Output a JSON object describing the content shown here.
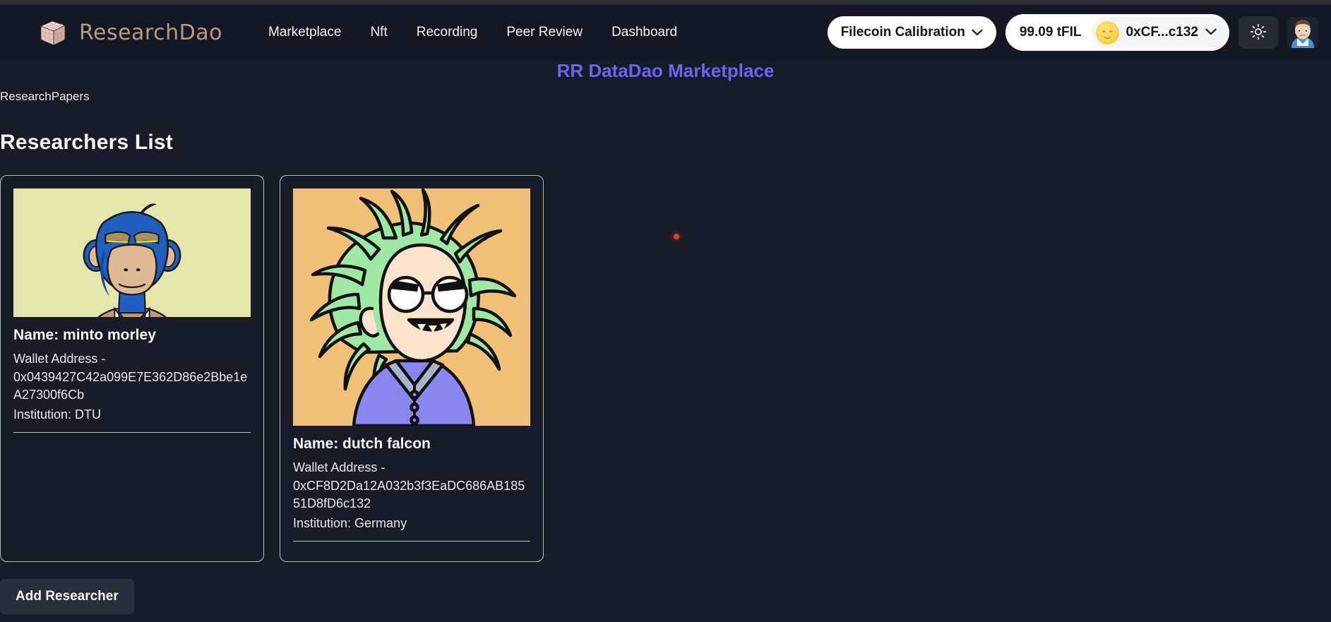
{
  "navbar": {
    "brand": "ResearchDao",
    "brand_icon": "cube-logo-icon",
    "links": [
      {
        "label": "Marketplace"
      },
      {
        "label": "Nft"
      },
      {
        "label": "Recording"
      },
      {
        "label": "Peer Review"
      },
      {
        "label": "Dashboard"
      }
    ],
    "network_selector": {
      "label": "Filecoin Calibration",
      "chevron_icon": "chevron-down-icon"
    },
    "wallet": {
      "balance": "99.09 tFIL",
      "address": "0xCF...c132",
      "avatar_icon": "wallet-jazzicon",
      "chevron_icon": "chevron-down-icon"
    },
    "theme_toggle_icon": "sun-icon",
    "profile_avatar_icon": "user-avatar-icon"
  },
  "page": {
    "title": "RR DataDao Marketplace",
    "breadcrumb": "ResearchPapers",
    "section_heading": "Researchers List"
  },
  "cards": [
    {
      "name_label": "Name: minto morley",
      "wallet_label": "Wallet Address -",
      "wallet_address": "0x0439427C42a099E7E362D86e2Bbe1eA27300f6Cb",
      "institution": "Institution: DTU",
      "nft_art": "bored-ape-blue-suit-avatar",
      "nft_bg": "#e4e6ac"
    },
    {
      "name_label": "Name: dutch falcon",
      "wallet_label": "Wallet Address -",
      "wallet_address": "0xCF8D2Da12A032b3f3EaDC686AB18551D8fD6c132",
      "institution": "Institution: Germany",
      "nft_art": "green-haired-scientist-avatar",
      "nft_bg": "#f0c078"
    }
  ],
  "actions": {
    "add_researcher": "Add Researcher"
  },
  "colors": {
    "page_bg": "#171c28",
    "navbar_bg": "#141824",
    "accent_title": "#6c63f2",
    "brand_text": "#b99a80",
    "card_border": "#b9bec9",
    "button_bg": "#2a2f3c",
    "cursor": "#e03a33"
  }
}
